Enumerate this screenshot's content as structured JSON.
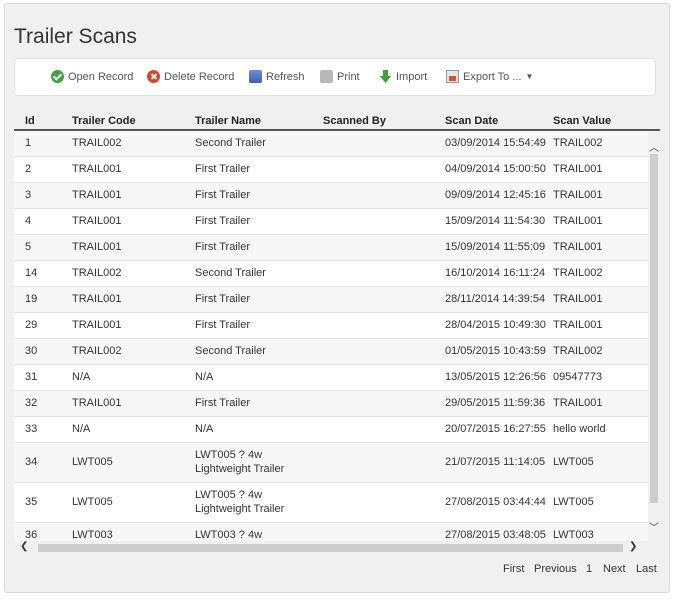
{
  "title": "Trailer Scans",
  "toolbar": {
    "open": "Open Record",
    "delete": "Delete Record",
    "refresh": "Refresh",
    "print": "Print",
    "import": "Import",
    "export": "Export To ..."
  },
  "columns": [
    "Id",
    "Trailer Code",
    "Trailer Name",
    "Scanned By",
    "Scan Date",
    "Scan Value"
  ],
  "rows": [
    {
      "id": "1",
      "code": "TRAIL002",
      "name1": "Second Trailer",
      "name2": "",
      "by": "",
      "date": "03/09/2014 15:54:49",
      "value": "TRAIL002"
    },
    {
      "id": "2",
      "code": "TRAIL001",
      "name1": "First Trailer",
      "name2": "",
      "by": "",
      "date": "04/09/2014 15:00:50",
      "value": "TRAIL001"
    },
    {
      "id": "3",
      "code": "TRAIL001",
      "name1": "First Trailer",
      "name2": "",
      "by": "",
      "date": "09/09/2014 12:45:16",
      "value": "TRAIL001"
    },
    {
      "id": "4",
      "code": "TRAIL001",
      "name1": "First Trailer",
      "name2": "",
      "by": "",
      "date": "15/09/2014 11:54:30",
      "value": "TRAIL001"
    },
    {
      "id": "5",
      "code": "TRAIL001",
      "name1": "First Trailer",
      "name2": "",
      "by": "",
      "date": "15/09/2014 11:55:09",
      "value": "TRAIL001"
    },
    {
      "id": "14",
      "code": "TRAIL002",
      "name1": "Second Trailer",
      "name2": "",
      "by": "",
      "date": "16/10/2014 16:11:24",
      "value": "TRAIL002"
    },
    {
      "id": "19",
      "code": "TRAIL001",
      "name1": "First Trailer",
      "name2": "",
      "by": "",
      "date": "28/11/2014 14:39:54",
      "value": "TRAIL001"
    },
    {
      "id": "29",
      "code": "TRAIL001",
      "name1": "First Trailer",
      "name2": "",
      "by": "",
      "date": "28/04/2015 10:49:30",
      "value": "TRAIL001"
    },
    {
      "id": "30",
      "code": "TRAIL002",
      "name1": "Second Trailer",
      "name2": "",
      "by": "",
      "date": "01/05/2015 10:43:59",
      "value": "TRAIL002"
    },
    {
      "id": "31",
      "code": "N/A",
      "name1": "N/A",
      "name2": "",
      "by": "",
      "date": "13/05/2015 12:26:56",
      "value": "09547773"
    },
    {
      "id": "32",
      "code": "TRAIL001",
      "name1": "First Trailer",
      "name2": "",
      "by": "",
      "date": "29/05/2015 11:59:36",
      "value": "TRAIL001"
    },
    {
      "id": "33",
      "code": "N/A",
      "name1": "N/A",
      "name2": "",
      "by": "",
      "date": "20/07/2015 16:27:55",
      "value": "hello world"
    },
    {
      "id": "34",
      "code": "LWT005",
      "name1": "LWT005 ? 4w",
      "name2": "Lightweight Trailer",
      "by": "",
      "date": "21/07/2015 11:14:05",
      "value": "LWT005"
    },
    {
      "id": "35",
      "code": "LWT005",
      "name1": "LWT005 ? 4w",
      "name2": "Lightweight Trailer",
      "by": "",
      "date": "27/08/2015 03:44:44",
      "value": "LWT005"
    },
    {
      "id": "36",
      "code": "LWT003",
      "name1": "LWT003 ? 4w",
      "name2": "",
      "by": "",
      "date": "27/08/2015 03:48:05",
      "value": "LWT003"
    }
  ],
  "pager": {
    "first": "First",
    "previous": "Previous",
    "page": "1",
    "next": "Next",
    "last": "Last"
  }
}
